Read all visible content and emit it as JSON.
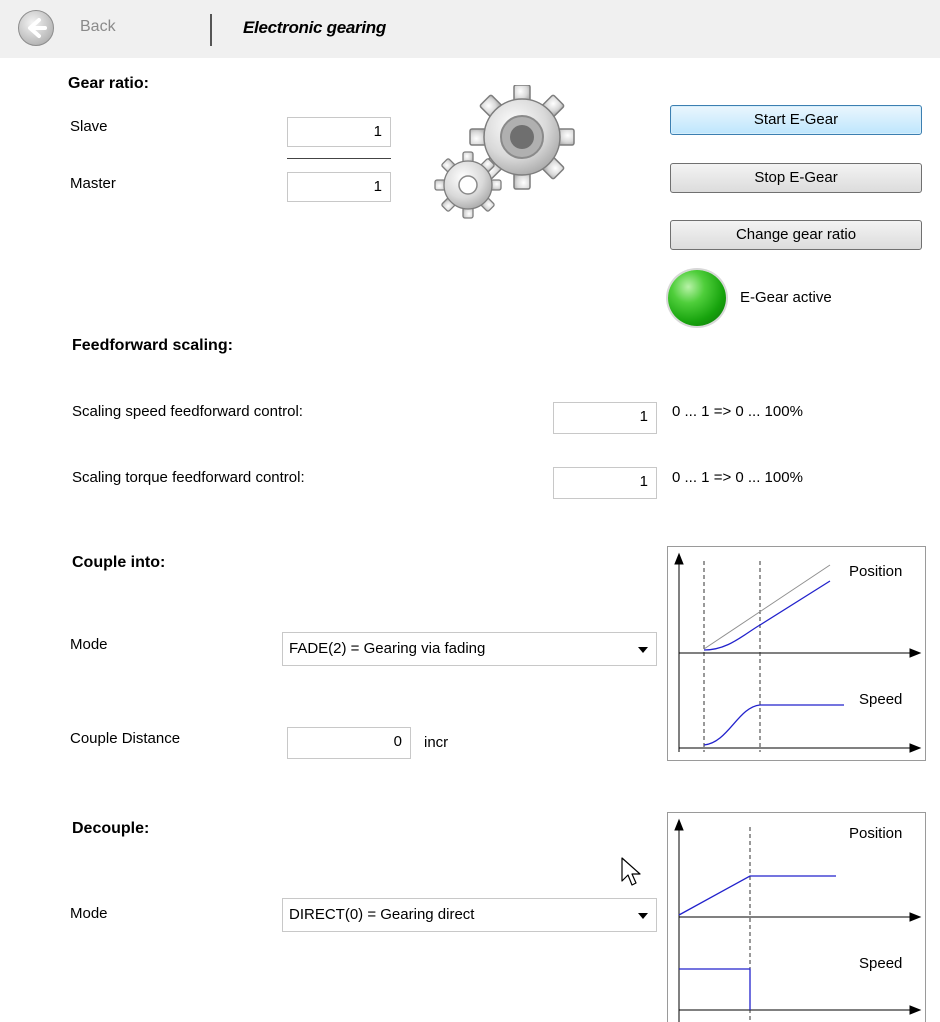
{
  "header": {
    "back_label": "Back",
    "title": "Electronic gearing"
  },
  "gear_ratio": {
    "title": "Gear ratio:",
    "slave_label": "Slave",
    "slave_value": "1",
    "master_label": "Master",
    "master_value": "1",
    "icon": "gears-icon"
  },
  "buttons": {
    "start": "Start E-Gear",
    "stop": "Stop E-Gear",
    "change": "Change gear ratio"
  },
  "status": {
    "label": "E-Gear active",
    "led_color": "#22b514",
    "active": true
  },
  "feedforward": {
    "title": "Feedforward scaling:",
    "speed_label": "Scaling speed feedforward control:",
    "speed_value": "1",
    "speed_range": "0 ... 1 => 0 ... 100%",
    "torque_label": "Scaling torque feedforward control:",
    "torque_value": "1",
    "torque_range": "0 ... 1 => 0 ... 100%"
  },
  "couple": {
    "title": "Couple into:",
    "mode_label": "Mode",
    "mode_value": "FADE(2) = Gearing via fading",
    "distance_label": "Couple Distance",
    "distance_value": "0",
    "distance_unit": "incr",
    "diagram": {
      "position_label": "Position",
      "speed_label": "Speed"
    }
  },
  "decouple": {
    "title": "Decouple:",
    "mode_label": "Mode",
    "mode_value": "DIRECT(0) = Gearing direct",
    "diagram": {
      "position_label": "Position",
      "speed_label": "Speed"
    }
  },
  "colors": {
    "curve": "#2222cc",
    "reference": "#909090",
    "button_focus": "#bee6fd"
  }
}
